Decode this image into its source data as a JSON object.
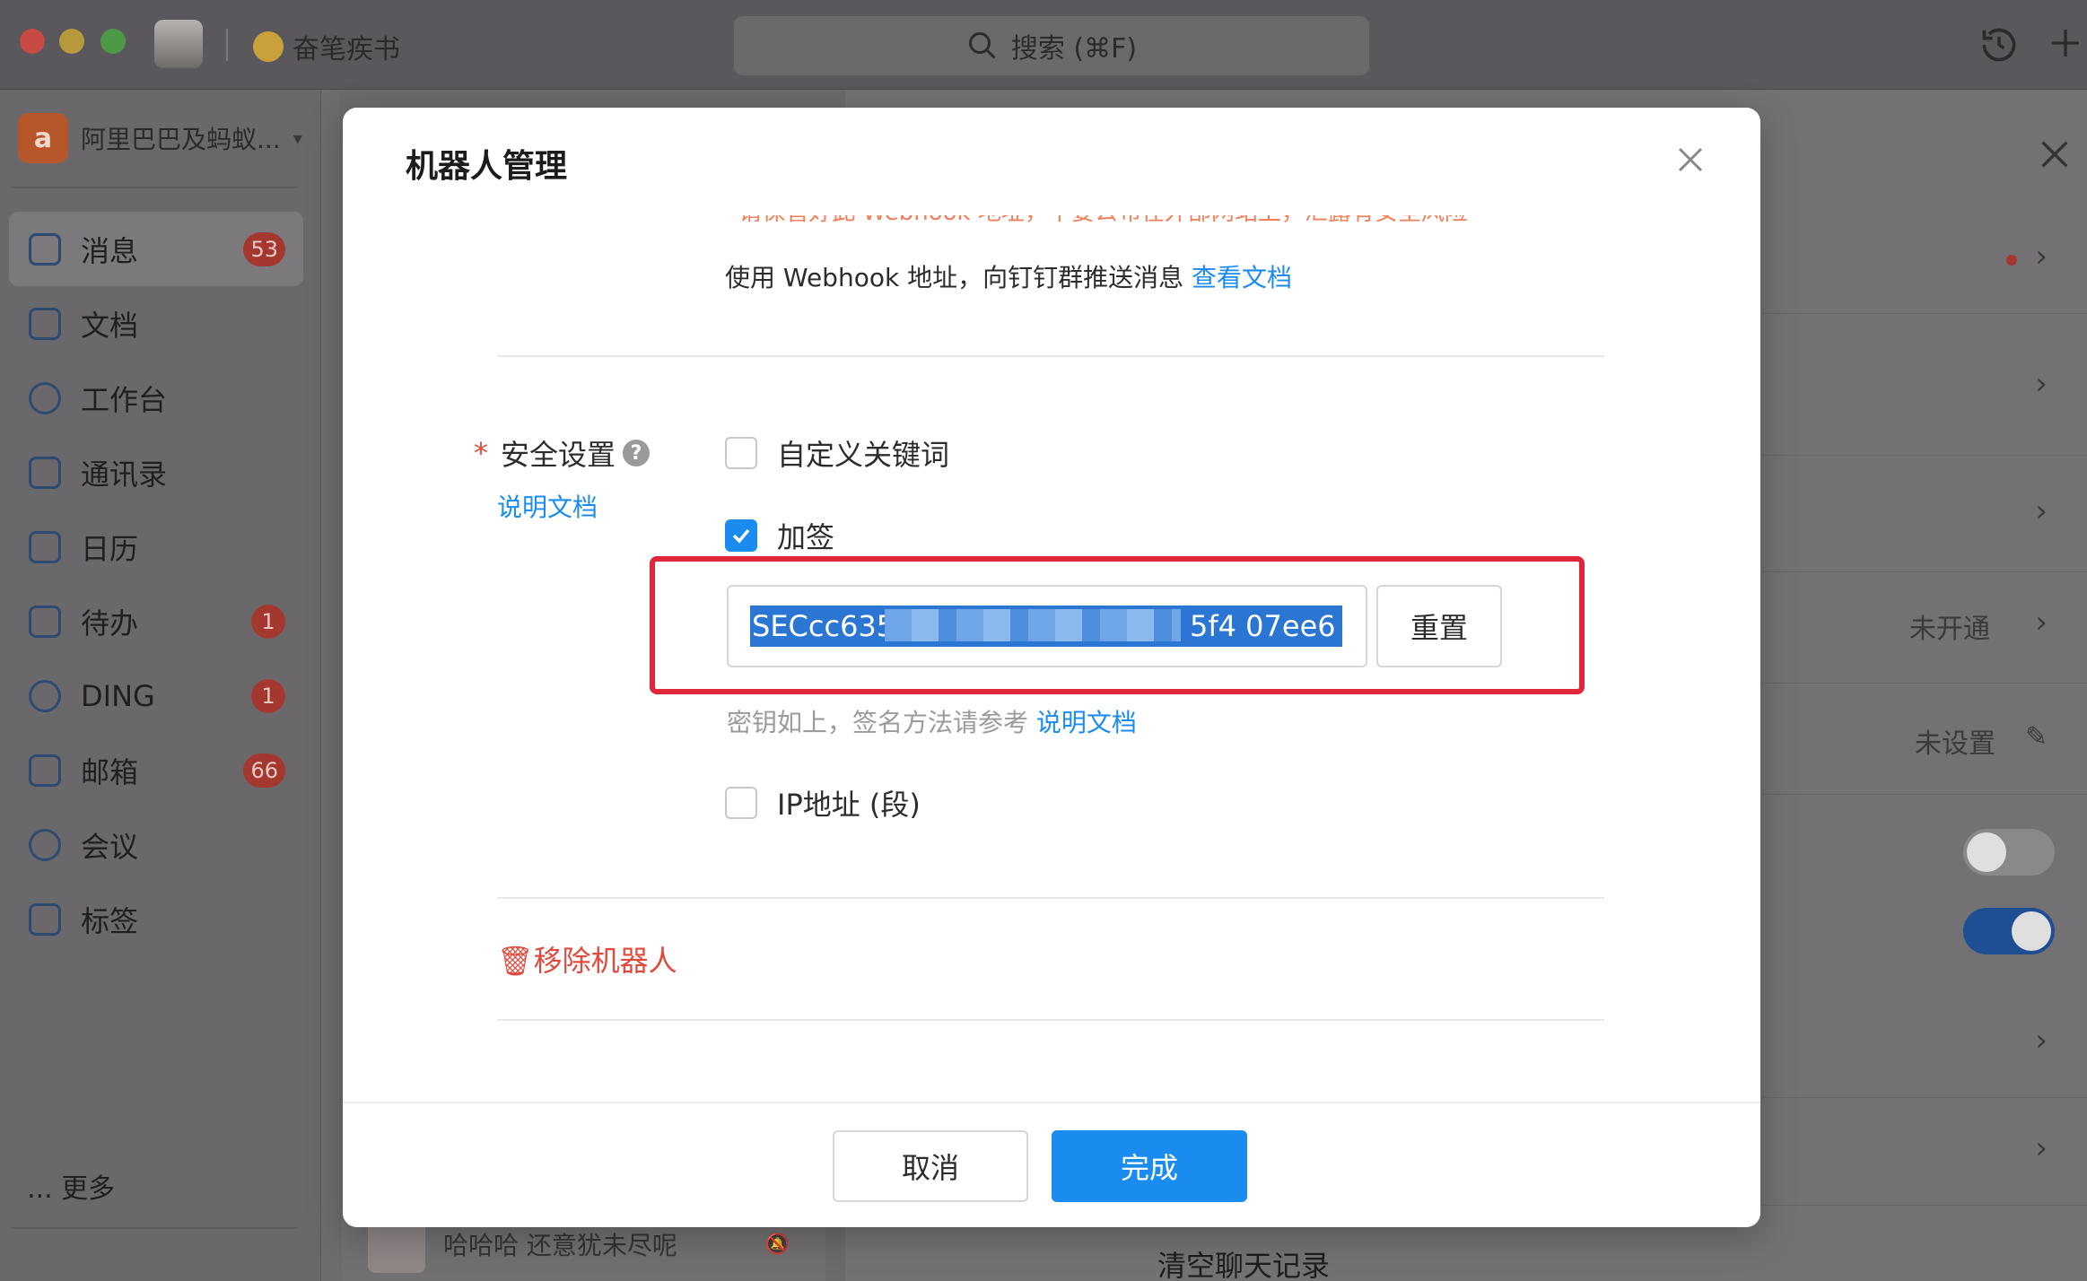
{
  "titlebar": {
    "app_name": "奋笔疾书",
    "search_placeholder": "搜索 (⌘F)"
  },
  "sidebar": {
    "org_name": "阿里巴巴及蚂蚁...",
    "items": [
      {
        "label": "消息",
        "badge": "53"
      },
      {
        "label": "文档",
        "badge": ""
      },
      {
        "label": "工作台",
        "badge": ""
      },
      {
        "label": "通讯录",
        "badge": ""
      },
      {
        "label": "日历",
        "badge": ""
      },
      {
        "label": "待办",
        "badge": "1"
      },
      {
        "label": "DING",
        "badge": "1"
      },
      {
        "label": "邮箱",
        "badge": "66"
      },
      {
        "label": "会议",
        "badge": ""
      },
      {
        "label": "标签",
        "badge": ""
      }
    ],
    "more_label": "... 更多"
  },
  "chat_preview": {
    "text": "哈哈哈 还意犹未尽呢"
  },
  "right_panel": {
    "not_activated": "未开通",
    "not_set": "未设置",
    "clear_chat": "清空聊天记录"
  },
  "modal": {
    "title": "机器人管理",
    "warning": "* 请保管好此 Webhook 地址，不要公布在外部网站上，泄露有安全风险",
    "webhook_text": "使用 Webhook 地址，向钉钉群推送消息",
    "webhook_link": "查看文档",
    "security_label": "安全设置",
    "security_doc_link": "说明文档",
    "options": {
      "custom_keyword": "自定义关键词",
      "sign": "加签",
      "ip": "IP地址 (段)"
    },
    "secret_value": "SECcc635",
    "secret_tail": "5f4  07ee6",
    "reset_label": "重置",
    "hint_text": "密钥如上，签名方法请参考",
    "hint_link": "说明文档",
    "remove_label": "移除机器人",
    "cancel_label": "取消",
    "done_label": "完成"
  }
}
